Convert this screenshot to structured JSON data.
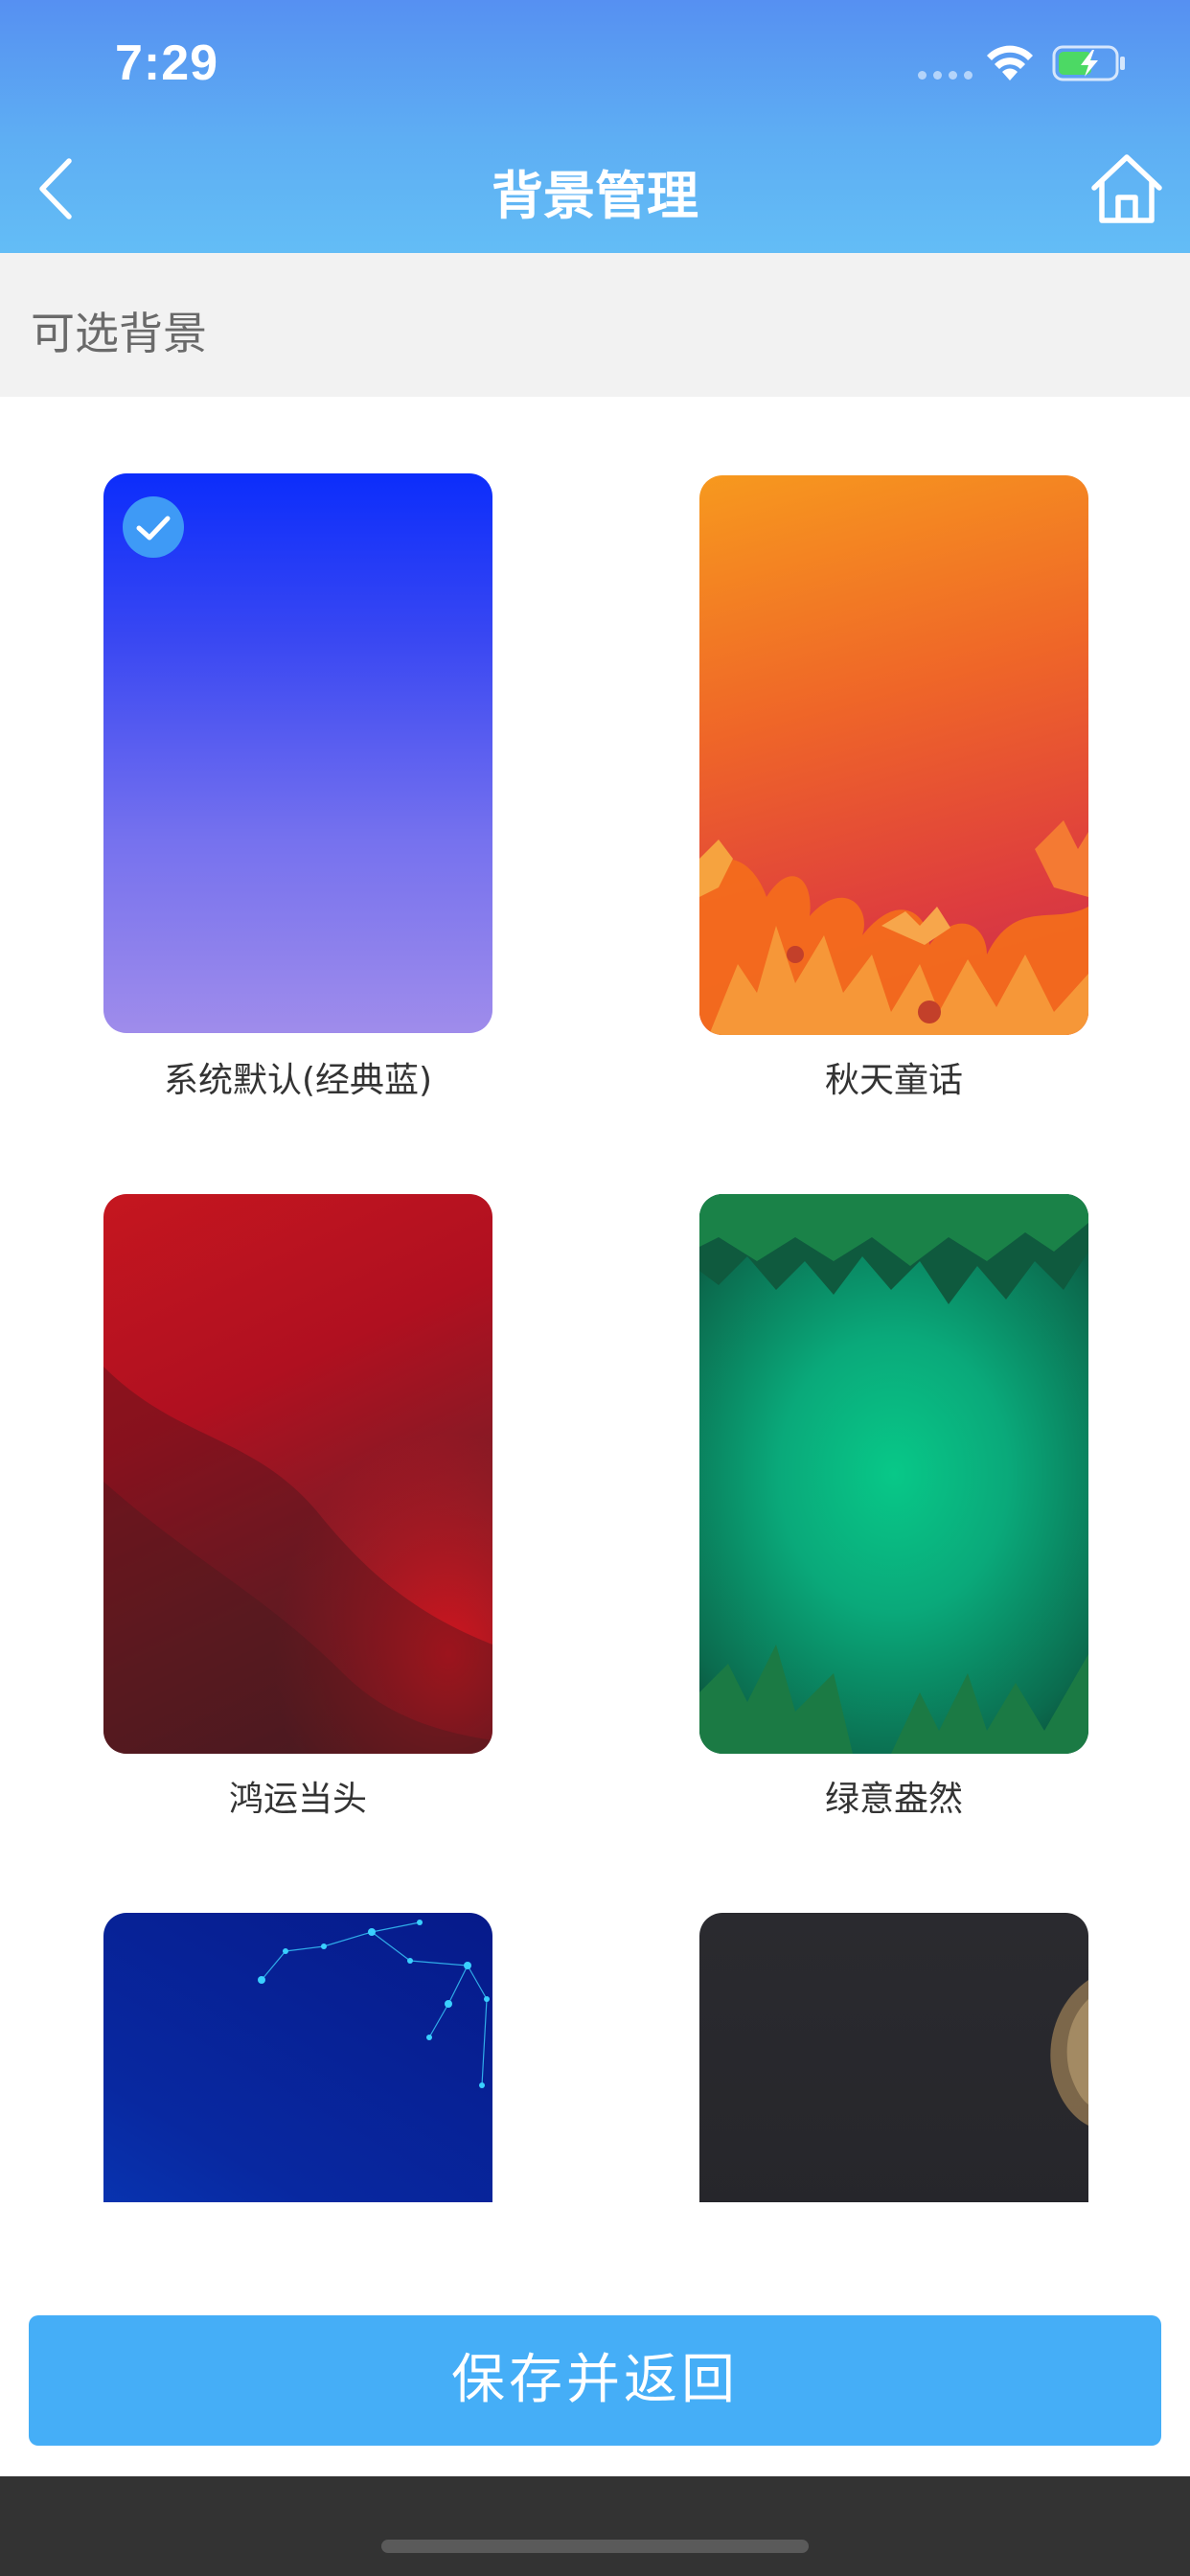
{
  "status_bar": {
    "time": "7:29"
  },
  "nav": {
    "title": "背景管理",
    "back_icon": "chevron-left-icon",
    "home_icon": "home-icon"
  },
  "section": {
    "title": "可选背景"
  },
  "backgrounds": [
    {
      "label": "系统默认(经典蓝)",
      "selected": true,
      "theme_colors": [
        "#0c2dfb",
        "#9f8ceb"
      ]
    },
    {
      "label": "秋天童话",
      "selected": false,
      "theme_colors": [
        "#f7991e",
        "#c62a4f"
      ]
    },
    {
      "label": "鸿运当头",
      "selected": false,
      "theme_colors": [
        "#c5161f",
        "#4b2027"
      ]
    },
    {
      "label": "绿意盎然",
      "selected": false,
      "theme_colors": [
        "#08c888",
        "#0a4e39"
      ]
    },
    {
      "label": "",
      "selected": false,
      "theme_colors": [
        "#061a8a",
        "#0a4bd0"
      ]
    },
    {
      "label": "",
      "selected": false,
      "theme_colors": [
        "#2a2a2f",
        "#232327"
      ]
    }
  ],
  "actions": {
    "save_label": "保存并返回"
  },
  "colors": {
    "header_gradient_start": "#5690f2",
    "header_gradient_end": "#63bdf6",
    "primary_button": "#45aef7",
    "check_badge": "#3e9af6"
  }
}
